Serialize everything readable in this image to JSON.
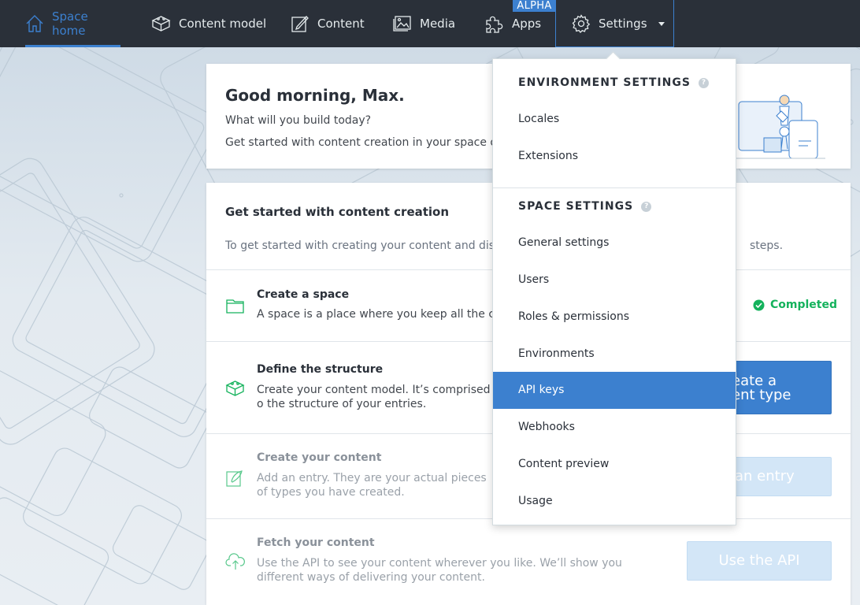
{
  "nav": {
    "items": [
      {
        "label": "Space home",
        "icon": "home-icon"
      },
      {
        "label": "Content model",
        "icon": "cube-icon"
      },
      {
        "label": "Content",
        "icon": "edit-icon"
      },
      {
        "label": "Media",
        "icon": "image-icon"
      },
      {
        "label": "Apps",
        "icon": "puzzle-icon"
      },
      {
        "label": "Settings",
        "icon": "gear-icon"
      }
    ],
    "alpha_badge": "ALPHA",
    "active": "Space home",
    "accent_color": "#3c80cf",
    "bar_color": "#2a3039"
  },
  "greeting": {
    "title": "Good morning, Max.",
    "line1": "What will you build today?",
    "line2": "Get started with content creation in your space or"
  },
  "get_started": {
    "title": "Get started with content creation",
    "description": "To get started with creating your content and distr",
    "description_end": "steps.",
    "steps": [
      {
        "title": "Create a space",
        "desc": "A space is a place where you keep all the co",
        "status": "Completed",
        "icon": "folder-icon"
      },
      {
        "title": "Define the structure",
        "desc": "Create your content model. It’s comprised o the structure of your entries.",
        "button_line1": "eate a",
        "button_line2": "ent type",
        "icon": "cube-icon"
      },
      {
        "title": "Create your content",
        "desc": "Add an entry. They are your actual pieces of types you have created.",
        "button": "an entry",
        "icon": "edit-icon"
      },
      {
        "title": "Fetch your content",
        "desc": "Use the API to see your content wherever you like. We’ll show you different ways of delivering your content.",
        "button": "Use the API",
        "icon": "cloud-upload-icon"
      }
    ]
  },
  "settings_menu": {
    "environment_heading": "ENVIRONMENT SETTINGS",
    "environment_items": [
      "Locales",
      "Extensions"
    ],
    "space_heading": "SPACE SETTINGS",
    "space_items": [
      "General settings",
      "Users",
      "Roles & permissions",
      "Environments",
      "API keys",
      "Webhooks",
      "Content preview",
      "Usage"
    ],
    "selected": "API keys"
  }
}
